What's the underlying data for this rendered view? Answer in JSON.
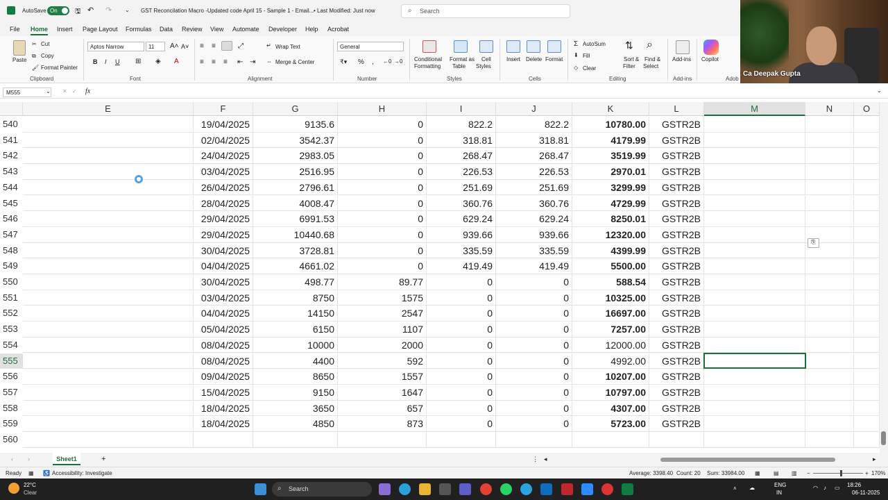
{
  "titlebar": {
    "autosave_label": "AutoSave",
    "autosave_state": "On",
    "doc_title": "GST Reconcilation Macro -Updated code April 15 - Sample 1 - Email...",
    "modified": "• Last Modified: Just now",
    "search_placeholder": "Search"
  },
  "menu": [
    "File",
    "Home",
    "Insert",
    "Page Layout",
    "Formulas",
    "Data",
    "Review",
    "View",
    "Automate",
    "Developer",
    "Help",
    "Acrobat"
  ],
  "ribbon": {
    "paste": "Paste",
    "cut": "Cut",
    "copy": "Copy",
    "format_painter": "Format Painter",
    "clipboard": "Clipboard",
    "font_name": "Aptos Narrow",
    "font_size": "11",
    "font": "Font",
    "wrap_text": "Wrap Text",
    "merge_center": "Merge & Center",
    "alignment": "Alignment",
    "number_format": "General",
    "number": "Number",
    "cond_format_1": "Conditional",
    "cond_format_2": "Formatting",
    "format_table_1": "Format as",
    "format_table_2": "Table",
    "cell_styles_1": "Cell",
    "cell_styles_2": "Styles",
    "styles": "Styles",
    "insert": "Insert",
    "delete": "Delete",
    "format": "Format",
    "cells": "Cells",
    "autosum": "AutoSum",
    "fill": "Fill",
    "clear": "Clear",
    "sort_filter_1": "Sort &",
    "sort_filter_2": "Filter",
    "find_select_1": "Find &",
    "find_select_2": "Select",
    "editing": "Editing",
    "addins": "Add-ins",
    "addins_group": "Add-ins",
    "copilot": "Copilot",
    "adobe": "Adob"
  },
  "webcam": {
    "name": "Ca Deepak Gupta"
  },
  "formula_bar": {
    "name_box": "M555",
    "fx": "fx",
    "value": ""
  },
  "grid": {
    "columns": [
      "E",
      "F",
      "G",
      "H",
      "I",
      "J",
      "K",
      "L",
      "M",
      "N",
      "O"
    ],
    "rows": [
      {
        "n": "540",
        "F": "19/04/2025",
        "G": "9135.6",
        "H": "0",
        "I": "822.2",
        "J": "822.2",
        "K": "10780.00",
        "L": "GSTR2B",
        "kb": true
      },
      {
        "n": "541",
        "F": "02/04/2025",
        "G": "3542.37",
        "H": "0",
        "I": "318.81",
        "J": "318.81",
        "K": "4179.99",
        "L": "GSTR2B",
        "kb": true
      },
      {
        "n": "542",
        "F": "24/04/2025",
        "G": "2983.05",
        "H": "0",
        "I": "268.47",
        "J": "268.47",
        "K": "3519.99",
        "L": "GSTR2B",
        "kb": true
      },
      {
        "n": "543",
        "F": "03/04/2025",
        "G": "2516.95",
        "H": "0",
        "I": "226.53",
        "J": "226.53",
        "K": "2970.01",
        "L": "GSTR2B",
        "kb": true
      },
      {
        "n": "544",
        "F": "26/04/2025",
        "G": "2796.61",
        "H": "0",
        "I": "251.69",
        "J": "251.69",
        "K": "3299.99",
        "L": "GSTR2B",
        "kb": true
      },
      {
        "n": "545",
        "F": "28/04/2025",
        "G": "4008.47",
        "H": "0",
        "I": "360.76",
        "J": "360.76",
        "K": "4729.99",
        "L": "GSTR2B",
        "kb": true
      },
      {
        "n": "546",
        "F": "29/04/2025",
        "G": "6991.53",
        "H": "0",
        "I": "629.24",
        "J": "629.24",
        "K": "8250.01",
        "L": "GSTR2B",
        "kb": true
      },
      {
        "n": "547",
        "F": "29/04/2025",
        "G": "10440.68",
        "H": "0",
        "I": "939.66",
        "J": "939.66",
        "K": "12320.00",
        "L": "GSTR2B",
        "kb": true
      },
      {
        "n": "548",
        "F": "30/04/2025",
        "G": "3728.81",
        "H": "0",
        "I": "335.59",
        "J": "335.59",
        "K": "4399.99",
        "L": "GSTR2B",
        "kb": true
      },
      {
        "n": "549",
        "F": "04/04/2025",
        "G": "4661.02",
        "H": "0",
        "I": "419.49",
        "J": "419.49",
        "K": "5500.00",
        "L": "GSTR2B",
        "kb": true
      },
      {
        "n": "550",
        "F": "30/04/2025",
        "G": "498.77",
        "H": "89.77",
        "I": "0",
        "J": "0",
        "K": "588.54",
        "L": "GSTR2B",
        "kb": true
      },
      {
        "n": "551",
        "F": "03/04/2025",
        "G": "8750",
        "H": "1575",
        "I": "0",
        "J": "0",
        "K": "10325.00",
        "L": "GSTR2B",
        "kb": true
      },
      {
        "n": "552",
        "F": "04/04/2025",
        "G": "14150",
        "H": "2547",
        "I": "0",
        "J": "0",
        "K": "16697.00",
        "L": "GSTR2B",
        "kb": true
      },
      {
        "n": "553",
        "F": "05/04/2025",
        "G": "6150",
        "H": "1107",
        "I": "0",
        "J": "0",
        "K": "7257.00",
        "L": "GSTR2B",
        "kb": true
      },
      {
        "n": "554",
        "F": "08/04/2025",
        "G": "10000",
        "H": "2000",
        "I": "0",
        "J": "0",
        "K": "12000.00",
        "L": "GSTR2B",
        "kb": false
      },
      {
        "n": "555",
        "F": "08/04/2025",
        "G": "4400",
        "H": "592",
        "I": "0",
        "J": "0",
        "K": "4992.00",
        "L": "GSTR2B",
        "kb": false
      },
      {
        "n": "556",
        "F": "09/04/2025",
        "G": "8650",
        "H": "1557",
        "I": "0",
        "J": "0",
        "K": "10207.00",
        "L": "GSTR2B",
        "kb": true
      },
      {
        "n": "557",
        "F": "15/04/2025",
        "G": "9150",
        "H": "1647",
        "I": "0",
        "J": "0",
        "K": "10797.00",
        "L": "GSTR2B",
        "kb": true
      },
      {
        "n": "558",
        "F": "18/04/2025",
        "G": "3650",
        "H": "657",
        "I": "0",
        "J": "0",
        "K": "4307.00",
        "L": "GSTR2B",
        "kb": true
      },
      {
        "n": "559",
        "F": "18/04/2025",
        "G": "4850",
        "H": "873",
        "I": "0",
        "J": "0",
        "K": "5723.00",
        "L": "GSTR2B",
        "kb": true
      },
      {
        "n": "560",
        "F": "",
        "G": "",
        "H": "",
        "I": "",
        "J": "",
        "K": "",
        "L": "",
        "kb": false
      }
    ],
    "selected_column": "M",
    "selected_row": "555"
  },
  "sheets": {
    "tab": "Sheet1",
    "add": "+"
  },
  "status": {
    "ready": "Ready",
    "accessibility": "Accessibility: Investigate",
    "average": "Average: 3398.40",
    "count": "Count: 20",
    "sum": "Sum: 33984.00",
    "zoom": "170%"
  },
  "taskbar": {
    "temp": "22°C",
    "weather": "Clear",
    "search": "Search",
    "lang_1": "ENG",
    "lang_2": "IN",
    "time": "18:26",
    "date": "06-11-2025"
  },
  "colors": {
    "accent": "#1e6e3c",
    "excel_green": "#107c41"
  }
}
